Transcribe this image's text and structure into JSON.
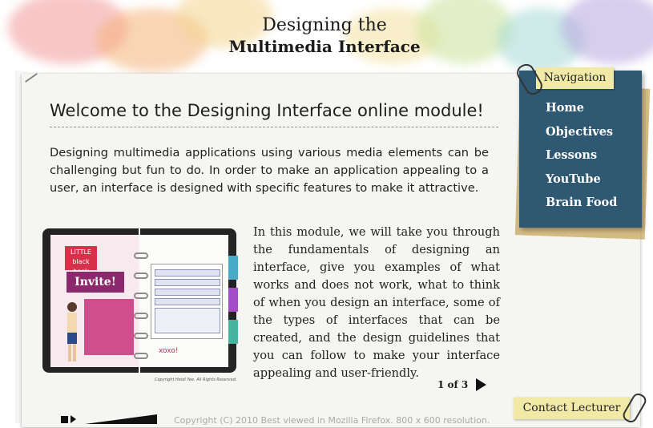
{
  "header": {
    "title_line1": "Designing the",
    "title_line2": "Multimedia Interface"
  },
  "main": {
    "heading": "Welcome to the Designing Interface online module!",
    "intro": "Designing multimedia applications using various media elements can be challenging but fun to do. In order to make an application appealing to a user, an interface is designed with specific features to make it attractive.",
    "body": "In this module, we will take you through the fundamentals of designing an interface, give you examples of what works and does not work, what to think of when you design an interface, some of the types of interfaces that can be created, and the design guidelines that you can follow to make your interface appealing and user-friendly.",
    "image": {
      "logo_text": "LITTLE black book",
      "invite_text": "Invite!",
      "xoxo_text": "xoxo!",
      "credit": "Copyright Heidi Yee. All Rights Reserved."
    },
    "pager": "1 of 3"
  },
  "navigation": {
    "tag": "Navigation",
    "items": [
      "Home",
      "Objectives",
      "Lessons",
      "YouTube",
      "Brain Food"
    ]
  },
  "contact": {
    "label": "Contact Lecturer"
  },
  "footer": {
    "copyright": "Copyright (C) 2010 Best viewed in Mozilla Firefox. 800 x 600 resolution."
  },
  "colors": {
    "nav_board": "#2f5873",
    "sticky_note": "#f1eaa7",
    "paper": "#f5f5f2"
  },
  "icons": [
    "paperclip-icon",
    "next-arrow-icon",
    "stop-icon",
    "play-icon",
    "volume-icon"
  ]
}
